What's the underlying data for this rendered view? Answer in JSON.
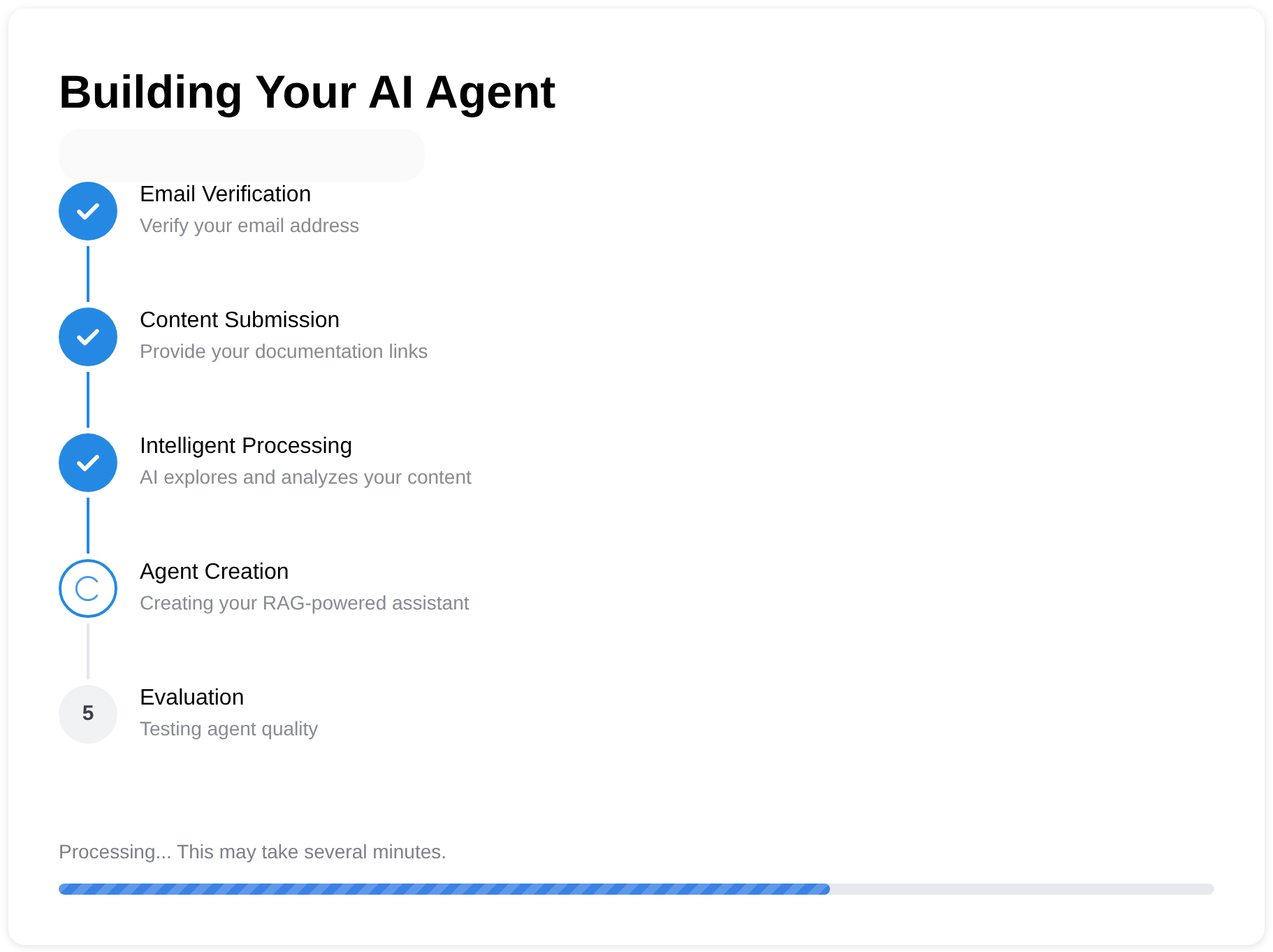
{
  "title": "Building Your AI Agent",
  "steps": [
    {
      "kind": "done",
      "title": "Email Verification",
      "description": "Verify your email address"
    },
    {
      "kind": "done",
      "title": "Content Submission",
      "description": "Provide your documentation links"
    },
    {
      "kind": "done",
      "title": "Intelligent Processing",
      "description": "AI explores and analyzes your content"
    },
    {
      "kind": "active",
      "title": "Agent Creation",
      "description": "Creating your RAG-powered assistant"
    },
    {
      "kind": "pending",
      "number": "5",
      "title": "Evaluation",
      "description": "Testing agent quality"
    }
  ],
  "status": "Processing... This may take several minutes.",
  "progress": {
    "level": 0.667
  }
}
